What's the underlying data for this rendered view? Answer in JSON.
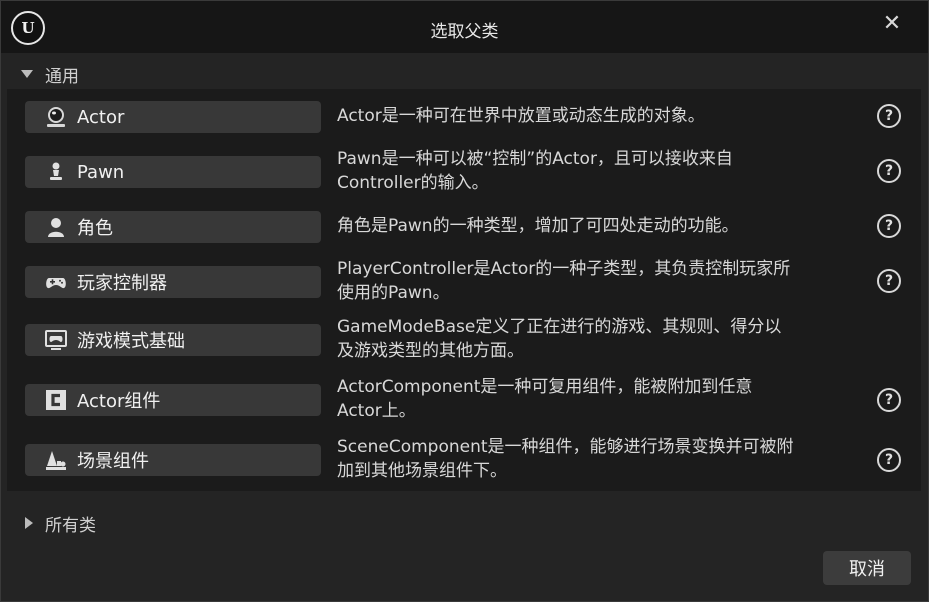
{
  "window": {
    "title": "选取父类",
    "logo": "U"
  },
  "common_section": {
    "label": "通用"
  },
  "classes": [
    {
      "icon": "actor-icon",
      "label": "Actor",
      "desc": [
        "Actor是一种可在世界中放置或动态生成的对象。"
      ]
    },
    {
      "icon": "pawn-icon",
      "label": "Pawn",
      "desc": [
        "Pawn是一种可以被“控制”的Actor，且可以接收来自",
        "Controller的输入。"
      ]
    },
    {
      "icon": "character-icon",
      "label": "角色",
      "desc": [
        "角色是Pawn的一种类型，增加了可四处走动的功能。"
      ]
    },
    {
      "icon": "gamepad-icon",
      "label": "玩家控制器",
      "desc": [
        "PlayerController是Actor的一种子类型，其负责控制玩家所",
        "使用的Pawn。"
      ]
    },
    {
      "icon": "game-mode-icon",
      "label": "游戏模式基础",
      "desc": [
        "GameModeBase定义了正在进行的游戏、其规则、得分以",
        "及游戏类型的其他方面。"
      ]
    },
    {
      "icon": "actor-component-icon",
      "label": "Actor组件",
      "desc": [
        "ActorComponent是一种可复用组件，能被附加到任意",
        "Actor上。"
      ]
    },
    {
      "icon": "scene-component-icon",
      "label": "场景组件",
      "desc": [
        "SceneComponent是一种组件，能够进行场景变换并可被附",
        "加到其他场景组件下。"
      ]
    }
  ],
  "all_classes_section": {
    "label": "所有类"
  },
  "footer": {
    "cancel_label": "取消"
  },
  "help_glyph": "?",
  "close_glyph": "✕"
}
